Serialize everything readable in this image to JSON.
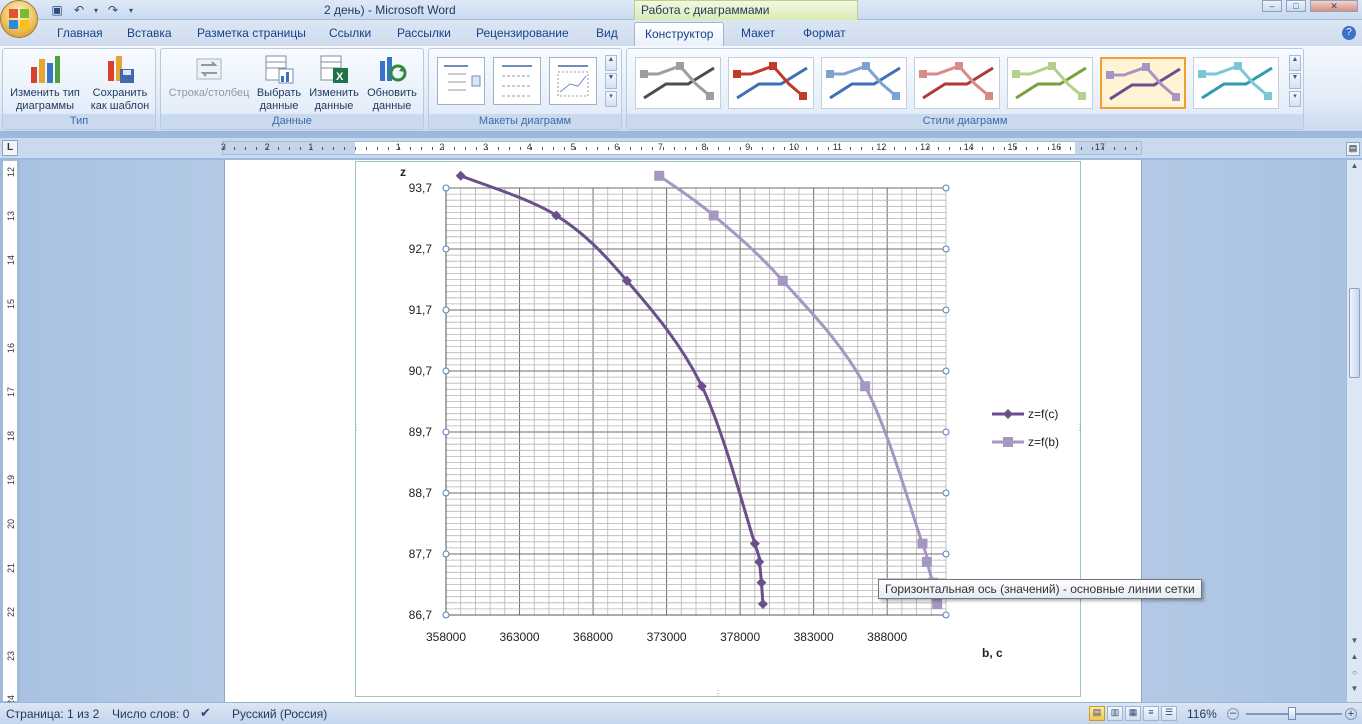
{
  "window": {
    "doc_title": "2 день) - Microsoft Word",
    "context_tab_title": "Работа с диаграммами",
    "minimize": "–",
    "maximize": "□",
    "close": "✕"
  },
  "tabs": [
    {
      "label": "Главная"
    },
    {
      "label": "Вставка"
    },
    {
      "label": "Разметка страницы"
    },
    {
      "label": "Ссылки"
    },
    {
      "label": "Рассылки"
    },
    {
      "label": "Рецензирование"
    },
    {
      "label": "Вид"
    },
    {
      "label": "Конструктор",
      "active": true
    },
    {
      "label": "Макет"
    },
    {
      "label": "Формат"
    }
  ],
  "ribbon": {
    "group_type": {
      "label": "Тип",
      "change_type_l1": "Изменить тип",
      "change_type_l2": "диаграммы",
      "save_template_l1": "Сохранить",
      "save_template_l2": "как шаблон"
    },
    "group_data": {
      "label": "Данные",
      "row_col": "Строка/столбец",
      "select_data_l1": "Выбрать",
      "select_data_l2": "данные",
      "edit_data_l1": "Изменить",
      "edit_data_l2": "данные",
      "refresh_data_l1": "Обновить",
      "refresh_data_l2": "данные"
    },
    "group_layouts": {
      "label": "Макеты диаграмм"
    },
    "group_styles": {
      "label": "Стили диаграмм",
      "styles": [
        {
          "line": "#4d4d4d",
          "accent": "#9e9e9e"
        },
        {
          "line": "#3f6fb8",
          "accent": "#c0392b"
        },
        {
          "line": "#3f6fb8",
          "accent": "#7fa3d1"
        },
        {
          "line": "#b03a3a",
          "accent": "#d98a8a"
        },
        {
          "line": "#77a13b",
          "accent": "#b5cf8e"
        },
        {
          "line": "#6a4f8c",
          "accent": "#a895c4",
          "selected": true
        },
        {
          "line": "#2f9bb0",
          "accent": "#7cc7d6"
        }
      ]
    }
  },
  "ruler": {
    "h_numbers": [
      "3",
      "2",
      "1",
      "1",
      "2",
      "3",
      "4",
      "5",
      "6",
      "7",
      "8",
      "9",
      "10",
      "11",
      "12",
      "13",
      "14",
      "15",
      "16",
      "17"
    ],
    "v_numbers": [
      "12",
      "13",
      "14",
      "15",
      "16",
      "17",
      "18",
      "19",
      "20",
      "21",
      "22",
      "23",
      "24"
    ],
    "corner": "L"
  },
  "chart_data": {
    "type": "line",
    "title": "",
    "ylabel": "z",
    "xlabel": "b, c",
    "xlim": [
      358000,
      392000
    ],
    "ylim": [
      86.7,
      93.7
    ],
    "x_ticks": [
      "358000",
      "363000",
      "368000",
      "373000",
      "378000",
      "383000",
      "388000"
    ],
    "x_tick_values": [
      358000,
      363000,
      368000,
      373000,
      378000,
      383000,
      388000
    ],
    "y_ticks": [
      "93,7",
      "92,7",
      "91,7",
      "90,7",
      "89,7",
      "88,7",
      "87,7",
      "86,7"
    ],
    "y_tick_values": [
      93.7,
      92.7,
      91.7,
      90.7,
      89.7,
      88.7,
      87.7,
      86.7
    ],
    "grid": "major and minor",
    "legend_position": "right",
    "series": [
      {
        "name": "z=f(c)",
        "color": "#6a4f8c",
        "marker": "diamond",
        "points": [
          [
            359000,
            93.9
          ],
          [
            365500,
            93.25
          ],
          [
            370300,
            92.18
          ],
          [
            375400,
            90.45
          ],
          [
            379000,
            87.87
          ],
          [
            379300,
            87.57
          ],
          [
            379450,
            87.23
          ],
          [
            379550,
            86.88
          ]
        ]
      },
      {
        "name": "z=f(b)",
        "color": "#a597c2",
        "marker": "square",
        "points": [
          [
            372500,
            93.9
          ],
          [
            376200,
            93.25
          ],
          [
            380900,
            92.18
          ],
          [
            386500,
            90.45
          ],
          [
            390400,
            87.87
          ],
          [
            390700,
            87.57
          ],
          [
            391100,
            87.23
          ],
          [
            391400,
            86.88
          ]
        ]
      }
    ]
  },
  "tooltip": {
    "text": "Горизонтальная ось (значений)  - основные линии сетки"
  },
  "status": {
    "page": "Страница: 1 из 2",
    "words": "Число слов: 0",
    "language": "Русский (Россия)",
    "zoom": "116%",
    "zoom_minus": "–",
    "zoom_plus": "+"
  }
}
